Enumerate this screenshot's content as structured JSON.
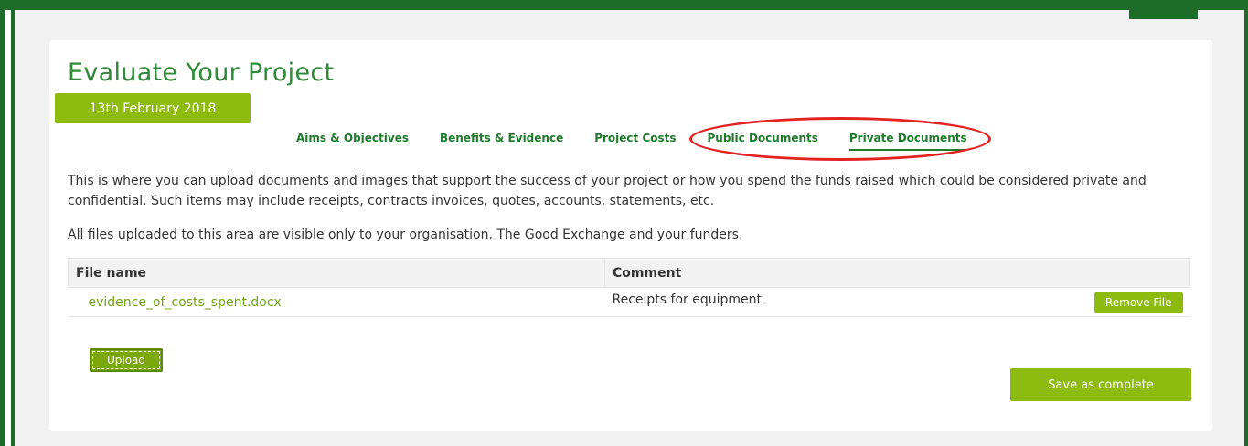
{
  "page": {
    "title": "Evaluate Your Project",
    "date": "13th February 2018"
  },
  "tabs": [
    {
      "label": "Aims & Objectives"
    },
    {
      "label": "Benefits & Evidence"
    },
    {
      "label": "Project Costs"
    },
    {
      "label": "Public Documents"
    },
    {
      "label": "Private Documents",
      "active": true
    }
  ],
  "content": {
    "intro": "This is where you can upload documents and images that support the success of your project or how you spend the funds raised which could be considered private and confidential. Such items may include receipts, contracts invoices, quotes, accounts, statements, etc.",
    "visibility_note": "All files uploaded to this area are visible only to your organisation, The Good Exchange and your funders."
  },
  "table": {
    "headers": {
      "file_name": "File name",
      "comment": "Comment"
    },
    "rows": [
      {
        "file_name": "evidence_of_costs_spent.docx",
        "comment": "Receipts for equipment",
        "action": "Remove File"
      }
    ]
  },
  "actions": {
    "upload": "Upload",
    "save": "Save as complete"
  },
  "colors": {
    "brand_dark_green": "#1f6b2a",
    "accent_lime": "#8dbb10",
    "highlight_red": "#e52222"
  }
}
